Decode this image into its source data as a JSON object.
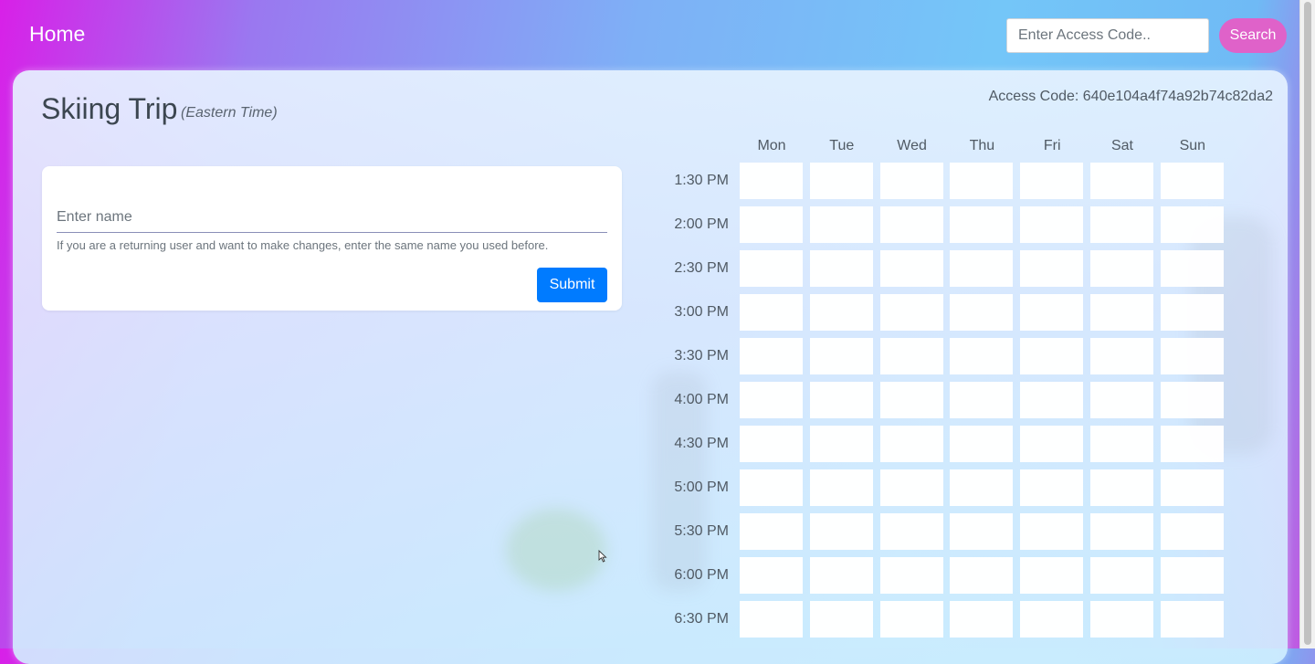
{
  "navbar": {
    "brand": "Home",
    "search_placeholder": "Enter Access Code..",
    "search_label": "Search"
  },
  "event": {
    "title": "Skiing Trip",
    "timezone": "(Eastern Time)",
    "access_code": "Access Code: 640e104a4f74a92b74c82da2"
  },
  "form": {
    "name_placeholder": "Enter name",
    "help_text": "If you are a returning user and want to make changes, enter the same name you used before.",
    "submit_label": "Submit"
  },
  "schedule": {
    "days": [
      "Mon",
      "Tue",
      "Wed",
      "Thu",
      "Fri",
      "Sat",
      "Sun"
    ],
    "times": [
      "1:30 PM",
      "2:00 PM",
      "2:30 PM",
      "3:00 PM",
      "3:30 PM",
      "4:00 PM",
      "4:30 PM",
      "5:00 PM",
      "5:30 PM",
      "6:00 PM",
      "6:30 PM"
    ]
  },
  "colors": {
    "search_button": "#df62c9",
    "submit_button": "#007bff"
  }
}
